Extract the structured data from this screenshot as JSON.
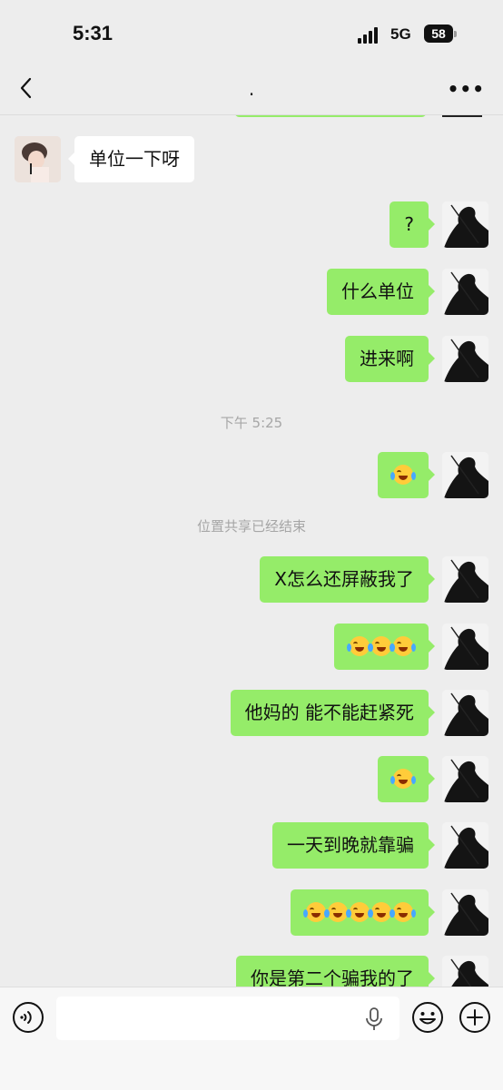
{
  "status": {
    "time": "5:31",
    "network": "5G",
    "battery": "58"
  },
  "header": {
    "title": ".",
    "more": "•••"
  },
  "messages": [
    {
      "side": "left",
      "text": "单位一下呀"
    },
    {
      "side": "right",
      "text": "?"
    },
    {
      "side": "right",
      "text": "什么单位"
    },
    {
      "side": "right",
      "text": "进来啊"
    },
    {
      "side": "system",
      "text": "下午 5:25"
    },
    {
      "side": "right",
      "emoji_count": 1
    },
    {
      "side": "system",
      "text": "位置共享已经结束"
    },
    {
      "side": "right",
      "text": "X怎么还屏蔽我了"
    },
    {
      "side": "right",
      "emoji_count": 3
    },
    {
      "side": "right",
      "text": "他妈的 能不能赶紧死"
    },
    {
      "side": "right",
      "emoji_count": 1
    },
    {
      "side": "right",
      "text": "一天到晚就靠骗"
    },
    {
      "side": "right",
      "emoji_count": 5
    },
    {
      "side": "right",
      "text": "你是第二个骗我的了"
    }
  ],
  "icons": {
    "back": "back-arrow-icon",
    "voice": "voice-mode-icon",
    "mic": "microphone-icon",
    "emoji": "emoji-icon",
    "plus": "plus-icon",
    "emoji_in_message": "laughing-crying-emoji-icon"
  },
  "colors": {
    "outgoing_bubble": "#95ec69",
    "incoming_bubble": "#ffffff",
    "background": "#ededed"
  }
}
